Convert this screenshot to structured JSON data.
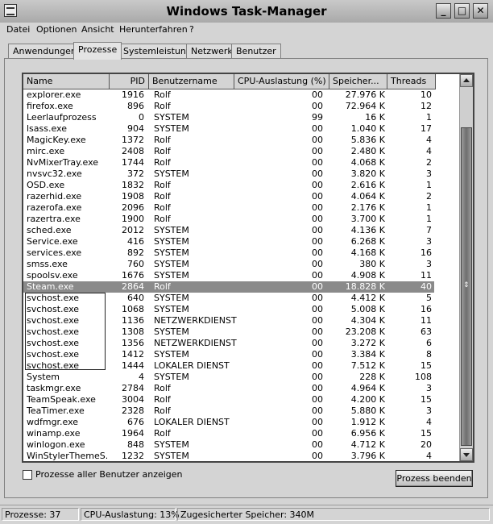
{
  "window": {
    "title": "Windows Task-Manager"
  },
  "menu": [
    "Datei",
    "Optionen",
    "Ansicht",
    "Herunterfahren",
    "?"
  ],
  "tabs": [
    "Anwendungen",
    "Prozesse",
    "Systemleistung",
    "Netzwerk",
    "Benutzer"
  ],
  "active_tab": "Prozesse",
  "columns": [
    "Name",
    "PID",
    "Benutzername",
    "CPU-Auslastung (%)",
    "Speicher...",
    "Threads"
  ],
  "processes": [
    {
      "name": "explorer.exe",
      "pid": "1916",
      "user": "Rolf",
      "cpu": "00",
      "mem": "27.976 K",
      "threads": "10"
    },
    {
      "name": "firefox.exe",
      "pid": "896",
      "user": "Rolf",
      "cpu": "00",
      "mem": "72.964 K",
      "threads": "12"
    },
    {
      "name": "Leerlaufprozess",
      "pid": "0",
      "user": "SYSTEM",
      "cpu": "99",
      "mem": "16 K",
      "threads": "1"
    },
    {
      "name": "lsass.exe",
      "pid": "904",
      "user": "SYSTEM",
      "cpu": "00",
      "mem": "1.040 K",
      "threads": "17"
    },
    {
      "name": "MagicKey.exe",
      "pid": "1372",
      "user": "Rolf",
      "cpu": "00",
      "mem": "5.836 K",
      "threads": "4"
    },
    {
      "name": "mirc.exe",
      "pid": "2408",
      "user": "Rolf",
      "cpu": "00",
      "mem": "2.480 K",
      "threads": "4"
    },
    {
      "name": "NvMixerTray.exe",
      "pid": "1744",
      "user": "Rolf",
      "cpu": "00",
      "mem": "4.068 K",
      "threads": "2"
    },
    {
      "name": "nvsvc32.exe",
      "pid": "372",
      "user": "SYSTEM",
      "cpu": "00",
      "mem": "3.820 K",
      "threads": "3"
    },
    {
      "name": "OSD.exe",
      "pid": "1832",
      "user": "Rolf",
      "cpu": "00",
      "mem": "2.616 K",
      "threads": "1"
    },
    {
      "name": "razerhid.exe",
      "pid": "1908",
      "user": "Rolf",
      "cpu": "00",
      "mem": "4.064 K",
      "threads": "2"
    },
    {
      "name": "razerofa.exe",
      "pid": "2096",
      "user": "Rolf",
      "cpu": "00",
      "mem": "2.176 K",
      "threads": "1"
    },
    {
      "name": "razertra.exe",
      "pid": "1900",
      "user": "Rolf",
      "cpu": "00",
      "mem": "3.700 K",
      "threads": "1"
    },
    {
      "name": "sched.exe",
      "pid": "2012",
      "user": "SYSTEM",
      "cpu": "00",
      "mem": "4.136 K",
      "threads": "7"
    },
    {
      "name": "Service.exe",
      "pid": "416",
      "user": "SYSTEM",
      "cpu": "00",
      "mem": "6.268 K",
      "threads": "3"
    },
    {
      "name": "services.exe",
      "pid": "892",
      "user": "SYSTEM",
      "cpu": "00",
      "mem": "4.168 K",
      "threads": "16"
    },
    {
      "name": "smss.exe",
      "pid": "760",
      "user": "SYSTEM",
      "cpu": "00",
      "mem": "380 K",
      "threads": "3"
    },
    {
      "name": "spoolsv.exe",
      "pid": "1676",
      "user": "SYSTEM",
      "cpu": "00",
      "mem": "4.908 K",
      "threads": "11"
    },
    {
      "name": "Steam.exe",
      "pid": "2864",
      "user": "Rolf",
      "cpu": "00",
      "mem": "18.828 K",
      "threads": "40",
      "selected": true
    },
    {
      "name": "svchost.exe",
      "pid": "640",
      "user": "SYSTEM",
      "cpu": "00",
      "mem": "4.412 K",
      "threads": "5"
    },
    {
      "name": "svchost.exe",
      "pid": "1068",
      "user": "SYSTEM",
      "cpu": "00",
      "mem": "5.008 K",
      "threads": "16"
    },
    {
      "name": "svchost.exe",
      "pid": "1136",
      "user": "NETZWERKDIENST",
      "cpu": "00",
      "mem": "4.304 K",
      "threads": "11"
    },
    {
      "name": "svchost.exe",
      "pid": "1308",
      "user": "SYSTEM",
      "cpu": "00",
      "mem": "23.208 K",
      "threads": "63"
    },
    {
      "name": "svchost.exe",
      "pid": "1356",
      "user": "NETZWERKDIENST",
      "cpu": "00",
      "mem": "3.272 K",
      "threads": "6"
    },
    {
      "name": "svchost.exe",
      "pid": "1412",
      "user": "SYSTEM",
      "cpu": "00",
      "mem": "3.384 K",
      "threads": "8"
    },
    {
      "name": "svchost.exe",
      "pid": "1444",
      "user": "LOKALER DIENST",
      "cpu": "00",
      "mem": "7.512 K",
      "threads": "15"
    },
    {
      "name": "System",
      "pid": "4",
      "user": "SYSTEM",
      "cpu": "00",
      "mem": "228 K",
      "threads": "108"
    },
    {
      "name": "taskmgr.exe",
      "pid": "2784",
      "user": "Rolf",
      "cpu": "00",
      "mem": "4.964 K",
      "threads": "3"
    },
    {
      "name": "TeamSpeak.exe",
      "pid": "3004",
      "user": "Rolf",
      "cpu": "00",
      "mem": "4.200 K",
      "threads": "15"
    },
    {
      "name": "TeaTimer.exe",
      "pid": "2328",
      "user": "Rolf",
      "cpu": "00",
      "mem": "5.880 K",
      "threads": "3"
    },
    {
      "name": "wdfmgr.exe",
      "pid": "676",
      "user": "LOKALER DIENST",
      "cpu": "00",
      "mem": "1.912 K",
      "threads": "4"
    },
    {
      "name": "winamp.exe",
      "pid": "1964",
      "user": "Rolf",
      "cpu": "00",
      "mem": "6.956 K",
      "threads": "15"
    },
    {
      "name": "winlogon.exe",
      "pid": "848",
      "user": "SYSTEM",
      "cpu": "00",
      "mem": "4.712 K",
      "threads": "20"
    },
    {
      "name": "WinStylerThemeS...",
      "pid": "1232",
      "user": "SYSTEM",
      "cpu": "00",
      "mem": "3.796 K",
      "threads": "4"
    }
  ],
  "show_all_users_label": "Prozesse aller Benutzer anzeigen",
  "end_process_label": "Prozess beenden",
  "status": {
    "processes": "Prozesse: 37",
    "cpu": "CPU-Auslastung: 13%",
    "memory": "Zugesicherter Speicher: 340M"
  }
}
